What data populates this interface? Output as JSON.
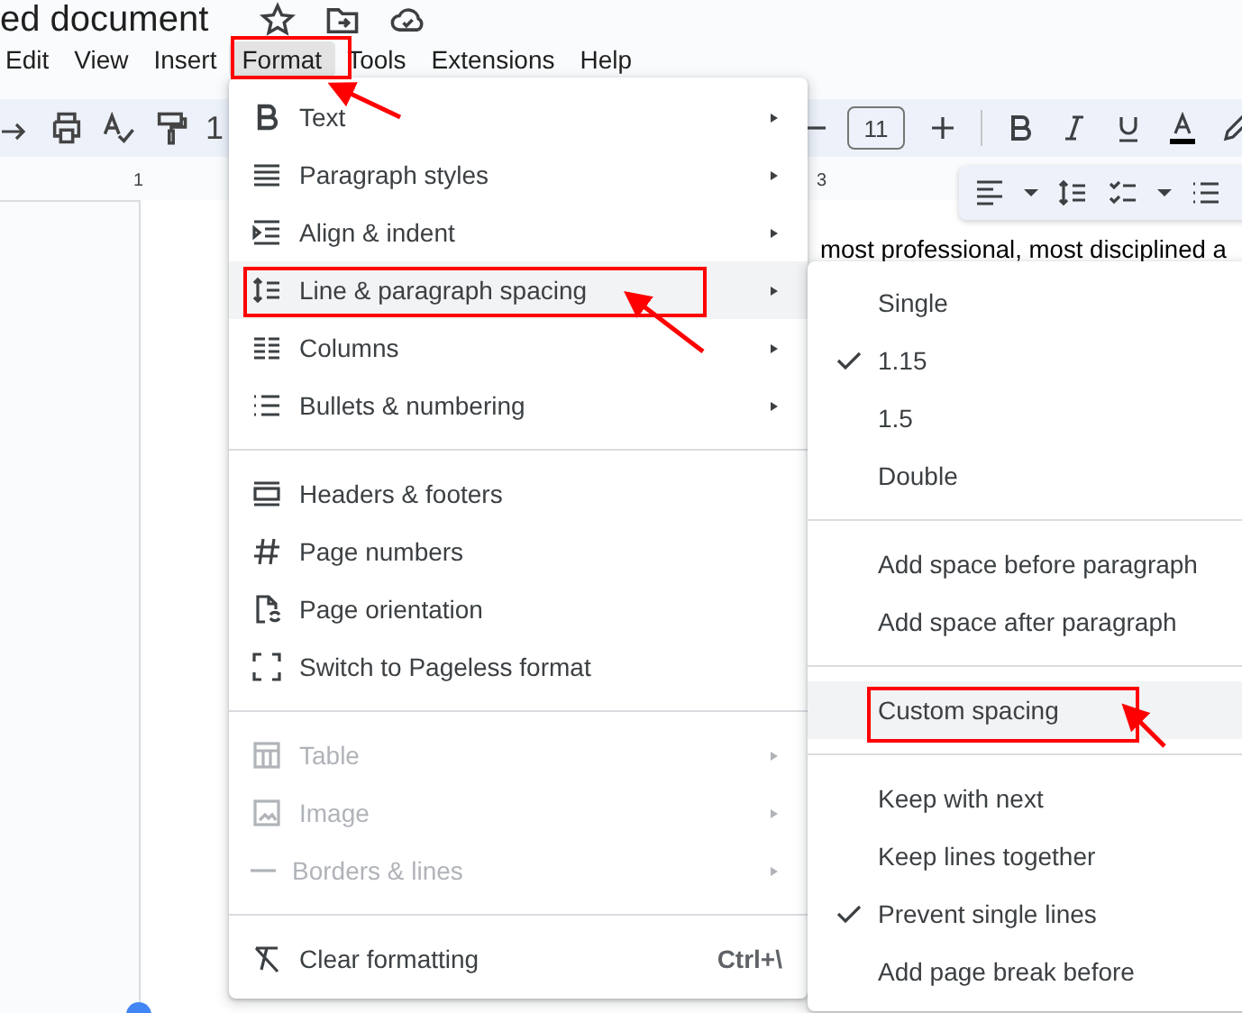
{
  "document_title": "ed document",
  "menubar": [
    {
      "label": "Edit",
      "selected": false
    },
    {
      "label": "View",
      "selected": false
    },
    {
      "label": "Insert",
      "selected": false
    },
    {
      "label": "Format",
      "selected": true
    },
    {
      "label": "Tools",
      "selected": false
    },
    {
      "label": "Extensions",
      "selected": false
    },
    {
      "label": "Help",
      "selected": false
    }
  ],
  "toolbar": {
    "zoom_partial": "1",
    "font_size": "11"
  },
  "ruler": [
    "1",
    "3"
  ],
  "document_text": "most professional, most disciplined a",
  "format_menu": [
    {
      "kind": "item",
      "label": "Text",
      "submenu": true,
      "disabled": false,
      "selected": false
    },
    {
      "kind": "item",
      "label": "Paragraph styles",
      "submenu": true,
      "disabled": false,
      "selected": false
    },
    {
      "kind": "item",
      "label": "Align & indent",
      "submenu": true,
      "disabled": false,
      "selected": false
    },
    {
      "kind": "item",
      "label": "Line & paragraph spacing",
      "submenu": true,
      "disabled": false,
      "selected": true
    },
    {
      "kind": "item",
      "label": "Columns",
      "submenu": true,
      "disabled": false,
      "selected": false
    },
    {
      "kind": "item",
      "label": "Bullets & numbering",
      "submenu": true,
      "disabled": false,
      "selected": false
    },
    {
      "kind": "divider"
    },
    {
      "kind": "item",
      "label": "Headers & footers",
      "submenu": false,
      "disabled": false,
      "selected": false
    },
    {
      "kind": "item",
      "label": "Page numbers",
      "submenu": false,
      "disabled": false,
      "selected": false
    },
    {
      "kind": "item",
      "label": "Page orientation",
      "submenu": false,
      "disabled": false,
      "selected": false
    },
    {
      "kind": "item",
      "label": "Switch to Pageless format",
      "submenu": false,
      "disabled": false,
      "selected": false
    },
    {
      "kind": "divider"
    },
    {
      "kind": "item",
      "label": "Table",
      "submenu": true,
      "disabled": true,
      "selected": false
    },
    {
      "kind": "item",
      "label": "Image",
      "submenu": true,
      "disabled": true,
      "selected": false
    },
    {
      "kind": "item",
      "label": "Borders & lines",
      "submenu": true,
      "disabled": true,
      "selected": false
    },
    {
      "kind": "divider"
    },
    {
      "kind": "item",
      "label": "Clear formatting",
      "shortcut": "Ctrl+\\",
      "submenu": false,
      "disabled": false,
      "selected": false
    }
  ],
  "spacing_submenu": [
    {
      "kind": "item",
      "label": "Single",
      "checked": false,
      "selected": false
    },
    {
      "kind": "item",
      "label": "1.15",
      "checked": true,
      "selected": false
    },
    {
      "kind": "item",
      "label": "1.5",
      "checked": false,
      "selected": false
    },
    {
      "kind": "item",
      "label": "Double",
      "checked": false,
      "selected": false
    },
    {
      "kind": "divider"
    },
    {
      "kind": "item",
      "label": "Add space before paragraph",
      "checked": false,
      "selected": false
    },
    {
      "kind": "item",
      "label": "Add space after paragraph",
      "checked": false,
      "selected": false
    },
    {
      "kind": "divider"
    },
    {
      "kind": "item",
      "label": "Custom spacing",
      "checked": false,
      "selected": true
    },
    {
      "kind": "divider"
    },
    {
      "kind": "item",
      "label": "Keep with next",
      "checked": false,
      "selected": false
    },
    {
      "kind": "item",
      "label": "Keep lines together",
      "checked": false,
      "selected": false
    },
    {
      "kind": "item",
      "label": "Prevent single lines",
      "checked": true,
      "selected": false
    },
    {
      "kind": "item",
      "label": "Add page break before",
      "checked": false,
      "selected": false
    }
  ]
}
